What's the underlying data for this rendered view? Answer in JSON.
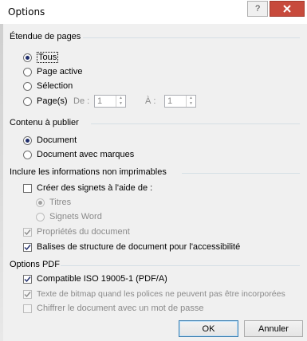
{
  "window": {
    "title": "Options",
    "help_glyph": "?",
    "close_glyph": "✕"
  },
  "page_range": {
    "title": "Étendue de pages",
    "all_label": "Tous",
    "current_label": "Page active",
    "selection_label": "Sélection",
    "pages_label": "Page(s)",
    "from_label": "De :",
    "from_value": "1",
    "to_label": "À :",
    "to_value": "1",
    "selected": "Tous"
  },
  "publish": {
    "title": "Contenu à publier",
    "document_label": "Document",
    "document_markup_label": "Document avec marques",
    "selected": "Document"
  },
  "nonprint": {
    "title": "Inclure les informations non imprimables",
    "bookmarks_label": "Créer des signets à l'aide de :",
    "bookmarks_checked": false,
    "headings_label": "Titres",
    "word_bookmarks_label": "Signets Word",
    "properties_label": "Propriétés du document",
    "properties_checked": true,
    "structure_label": "Balises de structure de document pour l'accessibilité",
    "structure_checked": true
  },
  "pdf": {
    "title": "Options PDF",
    "iso_label": "Compatible ISO 19005-1 (PDF/A)",
    "iso_checked": true,
    "bitmap_label": "Texte de bitmap quand les polices ne peuvent pas être incorporées",
    "bitmap_checked": true,
    "encrypt_label": "Chiffrer le document avec un mot de passe",
    "encrypt_checked": false
  },
  "buttons": {
    "ok": "OK",
    "cancel": "Annuler"
  },
  "colors": {
    "accent_dot": "#1f2d6b",
    "close_button": "#c74a3c",
    "check_mark": "#1f2d6b"
  }
}
